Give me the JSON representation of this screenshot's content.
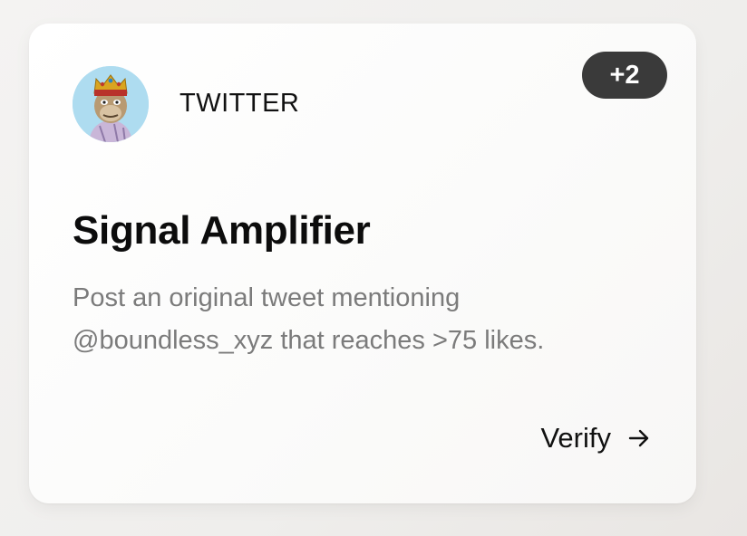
{
  "card": {
    "platform": "TWITTER",
    "badge": "+2",
    "title": "Signal Amplifier",
    "description": "Post an original tweet mentioning @boundless_xyz that reaches >75 likes.",
    "action_label": "Verify",
    "avatar_icon": "ape-avatar-icon",
    "action_icon": "arrow-right-icon"
  }
}
